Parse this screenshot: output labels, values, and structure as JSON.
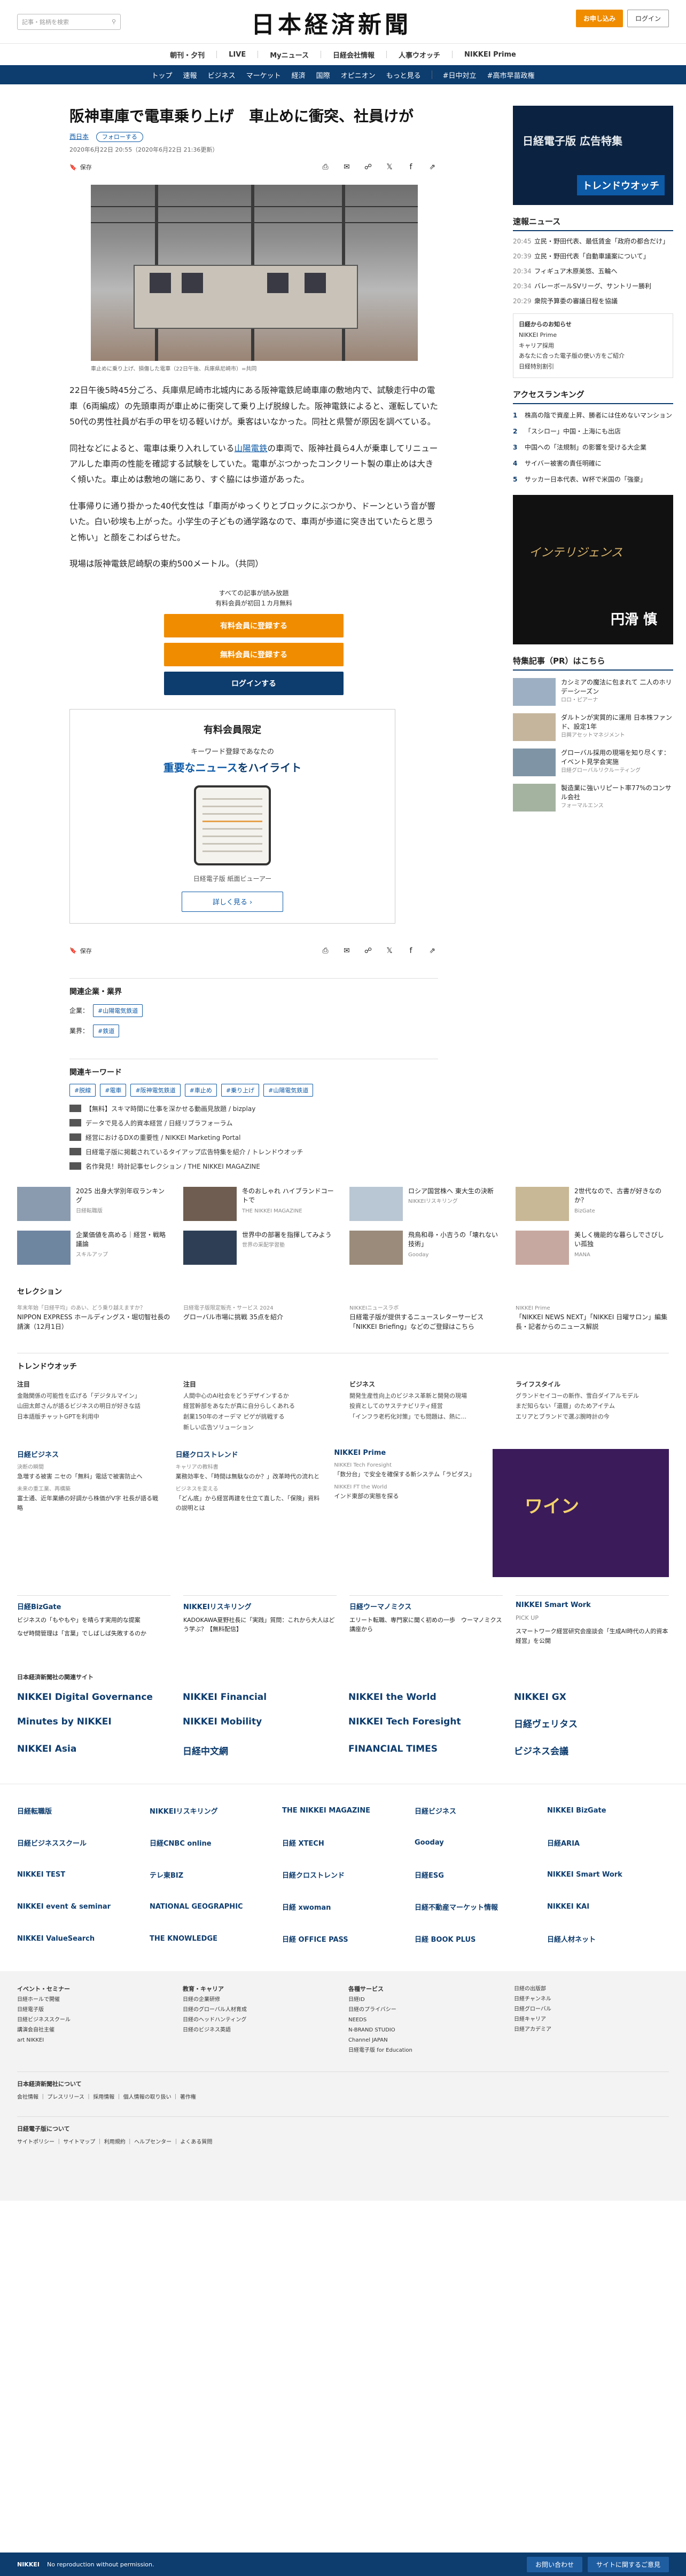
{
  "header": {
    "search_placeholder": "記事・銘柄を検索",
    "logo": "日本経済新聞",
    "signup": "お申し込み",
    "login": "ログイン"
  },
  "subnav": [
    "朝刊・夕刊",
    "LIVE",
    "Myニュース",
    "日経会社情報",
    "人事ウオッチ",
    "NIKKEI Prime"
  ],
  "mainnav": [
    "トップ",
    "速報",
    "ビジネス",
    "マーケット",
    "経済",
    "国際",
    "オピニオン",
    "もっと見る",
    "#日中対立",
    "#高市早苗政権"
  ],
  "article": {
    "title": "阪神車庫で電車乗り上げ　車止めに衝突、社員けが",
    "tag": "西日本",
    "follow": "フォローする",
    "date": "2020年6月22日 20:55（2020年6月22日 21:36更新）",
    "save": "保存",
    "caption": "車止めに乗り上げ、損傷した電車（22日午後、兵庫県尼崎市）=共同",
    "p1": "22日午後5時45分ごろ、兵庫県尼崎市北城内にある阪神電鉄尼崎車庫の敷地内で、試験走行中の電車（6両編成）の先頭車両が車止めに衝突して乗り上げ脱線した。阪神電鉄によると、運転していた50代の男性社員が右手の甲を切る軽いけが。乗客はいなかった。同社と県警が原因を調べている。",
    "p2_a": "同社などによると、電車は乗り入れしている",
    "p2_link": "山陽電鉄",
    "p2_b": "の車両で、阪神社員ら4人が乗車してリニューアルした車両の性能を確認する試験をしていた。電車がぶつかったコンクリート製の車止めは大きく傾いた。車止めは敷地の端にあり、すぐ脇には歩道があった。",
    "p3": "仕事帰りに通り掛かった40代女性は「車両がゆっくりとブロックにぶつかり、ドーンという音が響いた。白い砂埃も上がった。小学生の子どもの通学路なので、車両が歩道に突き出ていたらと思うと怖い」と顔をこわばらせた。",
    "p4": "現場は阪神電鉄尼崎駅の東約500メートル。（共同）"
  },
  "paywall": {
    "line1": "すべての記事が読み放題",
    "line2": "有料会員が初回１カ月無料",
    "btn1": "有料会員に登録する",
    "btn2": "無料会員に登録する",
    "btn3": "ログインする"
  },
  "promo": {
    "head": "有料会員限定",
    "kw": "キーワード登録であなたの",
    "hl_a": "重要なニュース",
    "hl_b": "をハイライト",
    "viewer": "日経電子版 紙面ビューアー",
    "more": "詳しく見る ›"
  },
  "related": {
    "title": "関連企業・業界",
    "company_label": "企業：",
    "company": "#山陽電気鉄道",
    "industry_label": "業界：",
    "industry": "#鉄道",
    "kw_title": "関連キーワード",
    "keywords": [
      "#脱線",
      "#電車",
      "#阪神電気鉄道",
      "#車止め",
      "#乗り上げ",
      "#山陽電気鉄道"
    ],
    "links": [
      "【無料】スキマ時間に仕事を深かせる動画見放題 / bizplay",
      "データで見る人的資本経営 / 日経リブラフォーラム",
      "経営におけるDXの重要性 / NIKKEI Marketing Portal",
      "日経電子版に掲載されているタイアップ広告特集を紹介 / トレンドウオッチ",
      "名作発見！時計記事セレクション / THE NIKKEI MAGAZINE"
    ]
  },
  "side": {
    "ad_text": "日経電子版 広告特集",
    "ad_brand": "トレンドウオッチ",
    "flash_title": "速報ニュース",
    "flash": [
      {
        "t": "20:45",
        "h": "立民・野田代表、最低賃金「政府の都合だけ」"
      },
      {
        "t": "20:39",
        "h": "立民・野田代表「自動車議案について」"
      },
      {
        "t": "20:34",
        "h": "フィギュア木原美悠、五輪へ"
      },
      {
        "t": "20:34",
        "h": "バレーボールSVリーグ、サントリー勝利"
      },
      {
        "t": "20:29",
        "h": "衆院予算委の審議日程を協議"
      }
    ],
    "box": [
      "日経からのお知らせ",
      "NIKKEI Prime",
      "キャリア採用",
      "あなたに合った電子版の使い方をご紹介",
      "日経特別割引"
    ],
    "rank_title": "アクセスランキング",
    "rank": [
      "株高の陰で資産上昇、勝者には住めないマンション",
      "「スシロー」中国・上海にも出店",
      "中国への「法規制」の影響を受ける大企業",
      "サイバー被害の責任明確に",
      "サッカー日本代表、W杯で米国の「強豪」"
    ],
    "ad2_text": "インテリジェンス",
    "ad2_name": "円滑 慎",
    "pr_title": "特集記事（PR）はこちら",
    "pr": [
      {
        "h": "カシミアの魔法に包まれて 二人のホリデーシーズン",
        "s": "ロロ・ピアーナ"
      },
      {
        "h": "ダルトンが実質的に運用 日本株ファンド、設定1年",
        "s": "日興アセットマネジメント"
      },
      {
        "h": "グローバル採用の現場を知り尽くす：イベント見学会実施",
        "s": "日経グローバルリクルーティング"
      },
      {
        "h": "製造業に強いリピート率77%のコンサル会社",
        "s": "フォーマルエンス"
      }
    ]
  },
  "cards": [
    {
      "h": "2025 出身大学別年収ランキング",
      "s": "日経転職版"
    },
    {
      "h": "冬のおしゃれ ハイブランドコートで",
      "s": "THE NIKKEI MAGAZINE"
    },
    {
      "h": "ロシア国営株へ 東大生の決断",
      "s": "NIKKEIリスキリング"
    },
    {
      "h": "2世代なので、古書が好きなのか？",
      "s": "BizGate"
    },
    {
      "h": "企業価値を高める｜経営・戦略議論",
      "s": "スキルアップ"
    },
    {
      "h": "世界中の部署を指揮してみよう",
      "s": "世界の采配学習塾"
    },
    {
      "h": "飛鳥和尋・小吉うの「壊れない技術」",
      "s": "Gooday"
    },
    {
      "h": "美しく機能的な暮らしでさびしい孤独",
      "s": "MANA"
    }
  ],
  "selection": {
    "title": "セレクション",
    "items": [
      {
        "s": "年末年始「日経平均」のあい、どう乗り越えますか？",
        "h": "NIPPON EXPRESS ホールディングス・堀切智社長の請演（12月1日）"
      },
      {
        "s": "日経電子版限定販売・サービス 2024",
        "h": "グローバル市場に挑戦 35点を紹介"
      },
      {
        "s": "NIKKEIニュースラボ",
        "h": "日経電子版が提供するニュースレターサービス「NIKKEI Briefing」などのご登録はこちら"
      },
      {
        "s": "NIKKEI Prime",
        "h": "「NIKKEI NEWS NEXT」「NIKKEI 日曜サロン」編集長・記者からのニュース解説"
      }
    ]
  },
  "trend": {
    "title": "トレンドウオッチ",
    "cols": [
      {
        "c": "注目",
        "items": [
          "金融関係の可能性を広げる「デジタルマイン」",
          "山田太郎さんが語るビジネスの明日が好きな話",
          "日本語版チャットGPTを利用中"
        ]
      },
      {
        "c": "注目",
        "items": [
          "人間中心のAI社会をどうデザインするか",
          "経営幹部をあなたが真に自分らしくあれる",
          "創業150年のオーデマ ピゲが挑戦する",
          "新しい広告ソリューション"
        ]
      },
      {
        "c": "ビジネス",
        "items": [
          "開発生産性向上のビジネス革新と開発の現場",
          "投資としてのサステナビリティ経営",
          "「インフラ老朽化対策」でも問題は、熱に..."
        ]
      },
      {
        "c": "ライフスタイル",
        "items": [
          "グランドセイコーの新作、雪白ダイアルモデル",
          "まだ知らない「還暦」のためアイテム",
          "エリアとブランドで選ぶ腕時計の今"
        ]
      }
    ]
  },
  "blocks": [
    {
      "t": "日経ビジネス",
      "items": [
        {
          "s": "決断の瞬間",
          "h": "急増する被害 ニセの「無料」電話で被害防止へ"
        },
        {
          "s": "未来の重工業、再構築",
          "h": "富士通、近年業績の好調から株価がV字 社長が語る戦略"
        }
      ]
    },
    {
      "t": "日経クロストレンド",
      "items": [
        {
          "s": "キャリアの教科書",
          "h": "業務効率を、「時間は無駄なのか？」改革時代の流れと"
        },
        {
          "s": "ビジネスを変える",
          "h": "「どん底」から経営再建を仕立て直した、「保険」資料の説明とは"
        }
      ]
    },
    {
      "t": "NIKKEI Prime",
      "items": [
        {
          "s": "NIKKEI Tech Foresight",
          "h": "「数分台」で安全を確保する新システム「ラピダス」"
        },
        {
          "s": "NIKKEI FT the World",
          "h": "インド東部の実態を探る"
        }
      ]
    }
  ],
  "ad3_text": "ワイン",
  "blocks2": [
    {
      "t": "日経BizGate",
      "items": [
        "ビジネスの「もやもや」を晴らす実用的な提案",
        "なぜ時間管理は「言葉」でしばしば失敗するのか"
      ]
    },
    {
      "t": "NIKKEIリスキリング",
      "items": [
        "KADOKAWA夏野社長に「実践」質問：これから大人はどう学ぶ？【無料配信】"
      ]
    },
    {
      "t": "日経ウーマノミクス",
      "items": [
        "エリート転職、専門家に聞く初めの一歩　ウーマノミクス講座から"
      ]
    },
    {
      "t": "NIKKEI Smart Work",
      "items": [
        "PICK UP",
        "スマートワーク経営研究会座談会「生成AI時代の人的資本経営」を公開"
      ]
    }
  ],
  "services": {
    "heading": "日本経済新聞社の関連サイト",
    "items": [
      "NIKKEI Digital Governance",
      "NIKKEI Financial",
      "NIKKEI the World",
      "NIKKEI GX",
      "Minutes by NIKKEI",
      "NIKKEI Mobility",
      "NIKKEI Tech Foresight",
      "日経ヴェリタス",
      "NIKKEI Asia",
      "日経中文網",
      "FINANCIAL TIMES",
      "ビジネス会議"
    ]
  },
  "brands": [
    "日経転職版",
    "NIKKEIリスキリング",
    "THE NIKKEI MAGAZINE",
    "日経ビジネス",
    "NIKKEI BizGate",
    "日経ビジネススクール",
    "日経CNBC online",
    "日経 XTECH",
    "Gooday",
    "日経ARIA",
    "NIKKEI TEST",
    "テレ東BIZ",
    "日経クロストレンド",
    "日経ESG",
    "NIKKEI Smart Work",
    "NIKKEI event & seminar",
    "NATIONAL GEOGRAPHIC",
    "日経 xwoman",
    "日経不動産マーケット情報",
    "NIKKEI KAI",
    "NIKKEI ValueSearch",
    "THE KNOWLEDGE",
    "日経 OFFICE PASS",
    "日経 BOOK PLUS",
    "日経人材ネット"
  ],
  "footer": {
    "cols": [
      {
        "h": "イベント・セミナー",
        "items": [
          "日経ホールで開催",
          "日経電子版",
          "日経ビジネススクール",
          "講演会自社主催",
          "art NIKKEI"
        ]
      },
      {
        "h": "教育・キャリア",
        "items": [
          "日経の企業研修",
          "日経のグローバル人材育成",
          "日経のヘッドハンティング",
          "日経のビジネス英語"
        ]
      },
      {
        "h": "各種サービス",
        "items": [
          "日経ID",
          "日経のプライバシー",
          "NEEDS",
          "N-BRAND STUDIO",
          "Channel JAPAN",
          "日経電子版 for Education"
        ]
      },
      {
        "h": "",
        "items": [
          "日経の出版部",
          "日経チャンネル",
          "日経グローバル",
          "日経キャリア",
          "日経アカデミア"
        ]
      }
    ],
    "line1_h": "日本経済新聞社について",
    "line1": "会社情報 ｜ プレスリリース ｜ 採用情報 ｜ 個人情報の取り扱い ｜ 著作権",
    "line2_h": "日経電子版について",
    "line2": "サイトポリシー ｜ サイトマップ ｜ 利用規約 ｜ ヘルプセンター ｜ よくある質問",
    "copyright": "No reproduction without permission.",
    "brand": "NIKKEI",
    "btn1": "お問い合わせ",
    "btn2": "サイトに関するご意見"
  }
}
